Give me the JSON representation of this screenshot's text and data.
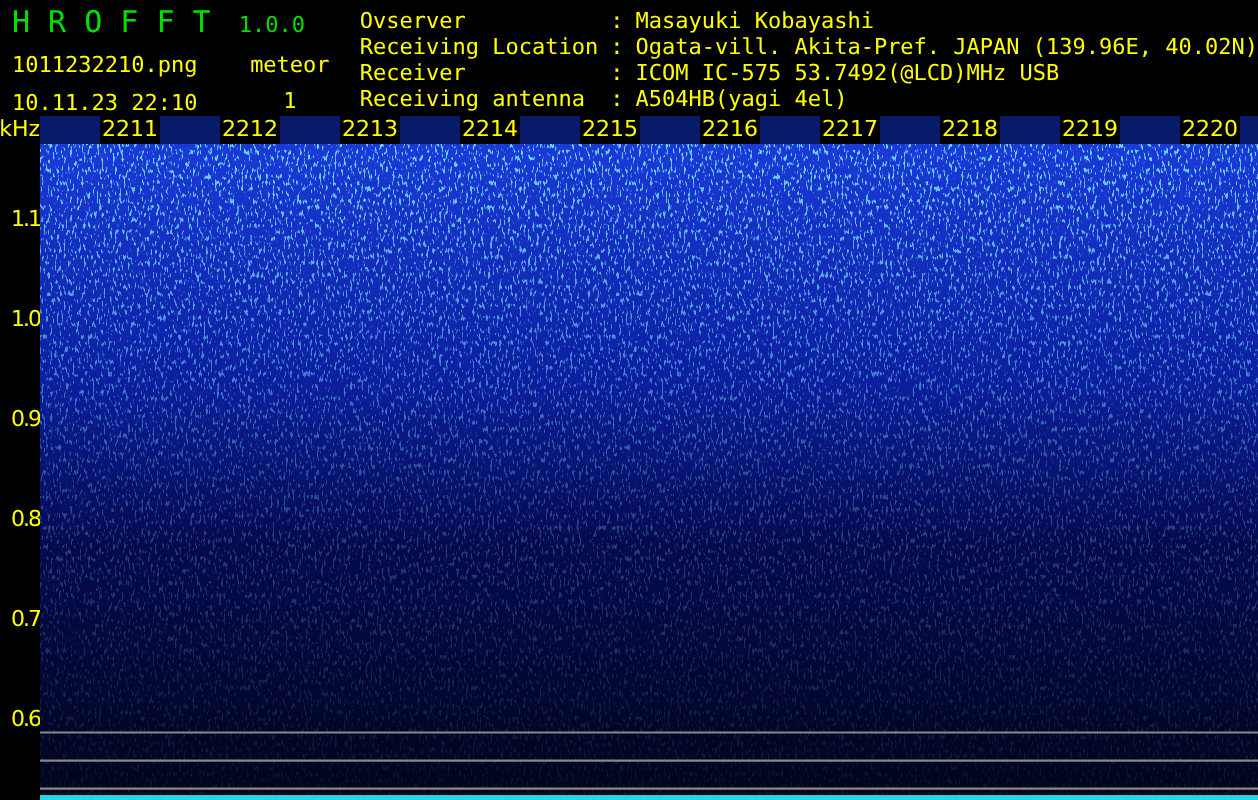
{
  "app": {
    "title": "H R O F F T",
    "version": "1.0.0"
  },
  "file": "1011232210.png",
  "datetime": "10.11.23 22:10",
  "meteor": {
    "label": "meteor",
    "count": "1"
  },
  "info": [
    {
      "label": "Ovserver",
      "separator": ":",
      "value": "Masayuki Kobayashi"
    },
    {
      "label": "Receiving Location",
      "separator": ":",
      "value": "Ogata-vill. Akita-Pref. JAPAN (139.96E, 40.02N)"
    },
    {
      "label": "Receiver",
      "separator": ":",
      "value": "ICOM IC-575 53.7492(@LCD)MHz USB"
    },
    {
      "label": "Receiving antenna",
      "separator": ":",
      "value": "A504HB(yagi 4el)"
    }
  ],
  "spectrogram": {
    "unit": "kHz",
    "time_labels": [
      "2211",
      "2212",
      "2213",
      "2214",
      "2215",
      "2216",
      "2217",
      "2218",
      "2219",
      "2220"
    ],
    "freq_labels": [
      "1.1",
      "1.0",
      "0.9",
      "0.8",
      "0.7",
      "0.6"
    ]
  }
}
